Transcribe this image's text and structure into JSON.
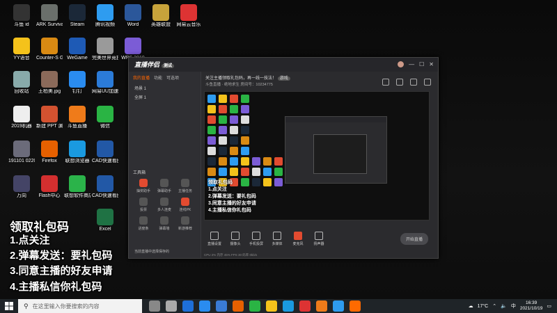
{
  "desktop": {
    "icons": [
      {
        "label": "斗鱼 id",
        "color": "#333"
      },
      {
        "label": "ARK Survival Evolved",
        "color": "#6a6f6b"
      },
      {
        "label": "Steam",
        "color": "#1b2838"
      },
      {
        "label": "腾讯视频",
        "color": "#2e9cf0"
      },
      {
        "label": "Word",
        "color": "#2b579a"
      },
      {
        "label": "英雄联盟",
        "color": "#c7a33b"
      },
      {
        "label": "网易云音乐",
        "color": "#d33"
      },
      {
        "label": "YY语音",
        "color": "#f4c21b"
      },
      {
        "label": "Counter-S Global Off...",
        "color": "#d98a13"
      },
      {
        "label": "WeGame",
        "color": "#1e5ab5"
      },
      {
        "label": "完美世界竞技平台",
        "color": "#9a9a9a"
      },
      {
        "label": "WPS 2019",
        "color": "#7b5cd6"
      },
      {
        "label": "回收站",
        "color": "#8aa"
      },
      {
        "label": "王柏美.jpg",
        "color": "#8b6a5a"
      },
      {
        "label": "钉钉",
        "color": "#2a8cf0"
      },
      {
        "label": "网易UU加速器",
        "color": "#2b7bd8"
      },
      {
        "label": "2019机器",
        "color": "#eee"
      },
      {
        "label": "新建 PPT 演示文稿",
        "color": "#d35230"
      },
      {
        "label": "斗鱼直播",
        "color": "#ef7b1a"
      },
      {
        "label": "微信",
        "color": "#2ab444"
      },
      {
        "label": "191101 0220洗衣",
        "color": "#6b6b7a"
      },
      {
        "label": "Firefox",
        "color": "#e66000"
      },
      {
        "label": "联想浏览器",
        "color": "#1a9ae0"
      },
      {
        "label": "CAD快速看图",
        "color": "#2258a6"
      },
      {
        "label": "万向",
        "color": "#446"
      },
      {
        "label": "Flash中心",
        "color": "#d32f2f"
      },
      {
        "label": "联想软件商店",
        "color": "#2bb34a"
      },
      {
        "label": "CAD快速看图-编辑器",
        "color": "#2258a6"
      },
      {
        "label": "Excel",
        "color": "#1f7244"
      }
    ],
    "overlay_lines": [
      "领取礼包码",
      "1.点关注",
      "2.弹幕发送：要礼包码",
      "3.同意主播的好友申请",
      "4.主播私信你礼包码"
    ]
  },
  "app": {
    "title": "直播伴侣",
    "badge": "测试",
    "left_tabs": [
      "我的直播",
      "功能",
      "可选项"
    ],
    "scenes": [
      "场景 1",
      "全屏 1"
    ],
    "tools_heading": "工具箱",
    "tools": [
      "抽奖助手",
      "弹幕助手",
      "主播任务",
      "投票",
      "多人连麦",
      "连线PK",
      "进度条",
      "弹幕墙",
      "新游推荐"
    ],
    "footer_note": "当前直播中选择保存的",
    "stream_title": "关注主播领取礼包码，再一线一技法！",
    "stream_tag": "游戏",
    "stream_meta": "斗鱼直播 · 绝地求生    房间号：10234775",
    "preview_lines": [
      "领取礼包码",
      "1.点关注",
      "2.弹幕发送：要礼包码",
      "3.同意主播的好友申请",
      "4.主播私信你礼包码"
    ],
    "bottom_tools": [
      "直播设置",
      "摄像头",
      "手机投屏",
      "多媒体",
      "麦克风",
      "扬声器"
    ],
    "start_button": "开始直播",
    "status": "CPU 2%  内存 45%  FPS 30  码率 0kb/s"
  },
  "taskbar": {
    "search_placeholder": "在这里输入你要搜索的内容",
    "temperature": "17°C",
    "ime": "中",
    "time": "16:39",
    "date": "2021/10/19"
  },
  "colors": {
    "accent": "#ff6a00",
    "taskbar": "#1f2428"
  }
}
